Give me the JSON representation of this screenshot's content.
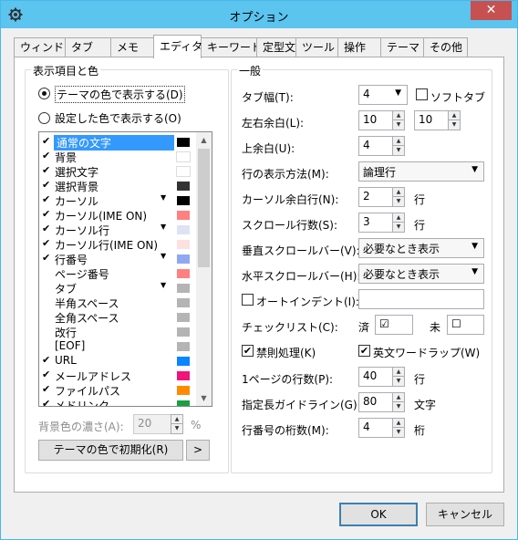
{
  "window": {
    "title": "オプション",
    "close_label": "✕"
  },
  "tabs": [
    {
      "label": "ウィンドウ"
    },
    {
      "label": "タブ"
    },
    {
      "label": "メモ"
    },
    {
      "label": "エディタ"
    },
    {
      "label": "キーワード"
    },
    {
      "label": "定型文"
    },
    {
      "label": "ツール"
    },
    {
      "label": "操作"
    },
    {
      "label": "テーマ"
    },
    {
      "label": "その他"
    }
  ],
  "active_tab": "エディタ",
  "display": {
    "group_title": "表示項目と色",
    "radio_theme": "テーマの色で表示する(D)",
    "radio_custom": "設定した色で表示する(O)",
    "items": [
      {
        "label": "通常の文字",
        "checked": true,
        "arrow": false,
        "color": "#000000"
      },
      {
        "label": "背景",
        "checked": true,
        "arrow": false,
        "color": "#ffffff"
      },
      {
        "label": "選択文字",
        "checked": true,
        "arrow": false,
        "color": "#ffffff"
      },
      {
        "label": "選択背景",
        "checked": true,
        "arrow": false,
        "color": "#333333"
      },
      {
        "label": "カーソル",
        "checked": true,
        "arrow": true,
        "color": "#000000"
      },
      {
        "label": "カーソル(IME ON)",
        "checked": true,
        "arrow": false,
        "color": "#ff8080"
      },
      {
        "label": "カーソル行",
        "checked": true,
        "arrow": true,
        "color": "#dde3f2"
      },
      {
        "label": "カーソル行(IME ON)",
        "checked": true,
        "arrow": false,
        "color": "#fde0e0"
      },
      {
        "label": "行番号",
        "checked": true,
        "arrow": true,
        "color": "#8fa8f0"
      },
      {
        "label": "ページ番号",
        "checked": false,
        "arrow": false,
        "color": "#ff8080"
      },
      {
        "label": "タブ",
        "checked": false,
        "arrow": true,
        "color": "#b4b4b4"
      },
      {
        "label": "半角スペース",
        "checked": false,
        "arrow": false,
        "color": "#b4b4b4"
      },
      {
        "label": "全角スペース",
        "checked": false,
        "arrow": false,
        "color": "#b4b4b4"
      },
      {
        "label": "改行",
        "checked": false,
        "arrow": false,
        "color": "#b4b4b4"
      },
      {
        "label": "[EOF]",
        "checked": false,
        "arrow": false,
        "color": "#b4b4b4"
      },
      {
        "label": "URL",
        "checked": true,
        "arrow": false,
        "color": "#0a84ff"
      },
      {
        "label": "メールアドレス",
        "checked": true,
        "arrow": false,
        "color": "#f0147a"
      },
      {
        "label": "ファイルパス",
        "checked": true,
        "arrow": false,
        "color": "#ff8c00"
      },
      {
        "label": "メドリンク",
        "checked": true,
        "arrow": false,
        "color": "#1aa040"
      }
    ],
    "bg_density_label": "背景色の濃さ(A):",
    "bg_density_value": "20",
    "bg_density_unit": "%",
    "reset_button": "テーマの色で初期化(R)",
    "more_button": ">"
  },
  "general": {
    "group_title": "一般",
    "tab_width_label": "タブ幅(T):",
    "tab_width_value": "4",
    "soft_tab_label": "ソフトタブ",
    "lr_margin_label": "左右余白(L):",
    "left_margin_value": "10",
    "right_margin_value": "10",
    "top_margin_label": "上余白(U):",
    "top_margin_value": "4",
    "line_display_label": "行の表示方法(M):",
    "line_display_value": "論理行",
    "cursor_margin_label": "カーソル余白行(N):",
    "cursor_margin_value": "2",
    "cursor_margin_unit": "行",
    "scroll_lines_label": "スクロール行数(S):",
    "scroll_lines_value": "3",
    "scroll_lines_unit": "行",
    "vscroll_label": "垂直スクロールバー(V):",
    "vscroll_value": "必要なとき表示",
    "hscroll_label": "水平スクロールバー(H):",
    "hscroll_value": "必要なとき表示",
    "auto_indent_label": "オートインデント(I):",
    "auto_indent_value": "",
    "checklist_label": "チェックリスト(C):",
    "checklist_done_label": "済",
    "checklist_done_value": "☑",
    "checklist_todo_label": "未",
    "checklist_todo_value": "☐",
    "kinsoku_label": "禁則処理(K)",
    "wordwrap_label": "英文ワードラップ(W)",
    "page_lines_label": "1ページの行数(P):",
    "page_lines_value": "40",
    "page_lines_unit": "行",
    "guide_label": "指定長ガイドライン(G):",
    "guide_value": "80",
    "guide_unit": "文字",
    "lineno_digits_label": "行番号の桁数(M):",
    "lineno_digits_value": "4",
    "lineno_digits_unit": "桁"
  },
  "footer": {
    "ok": "OK",
    "cancel": "キャンセル"
  }
}
